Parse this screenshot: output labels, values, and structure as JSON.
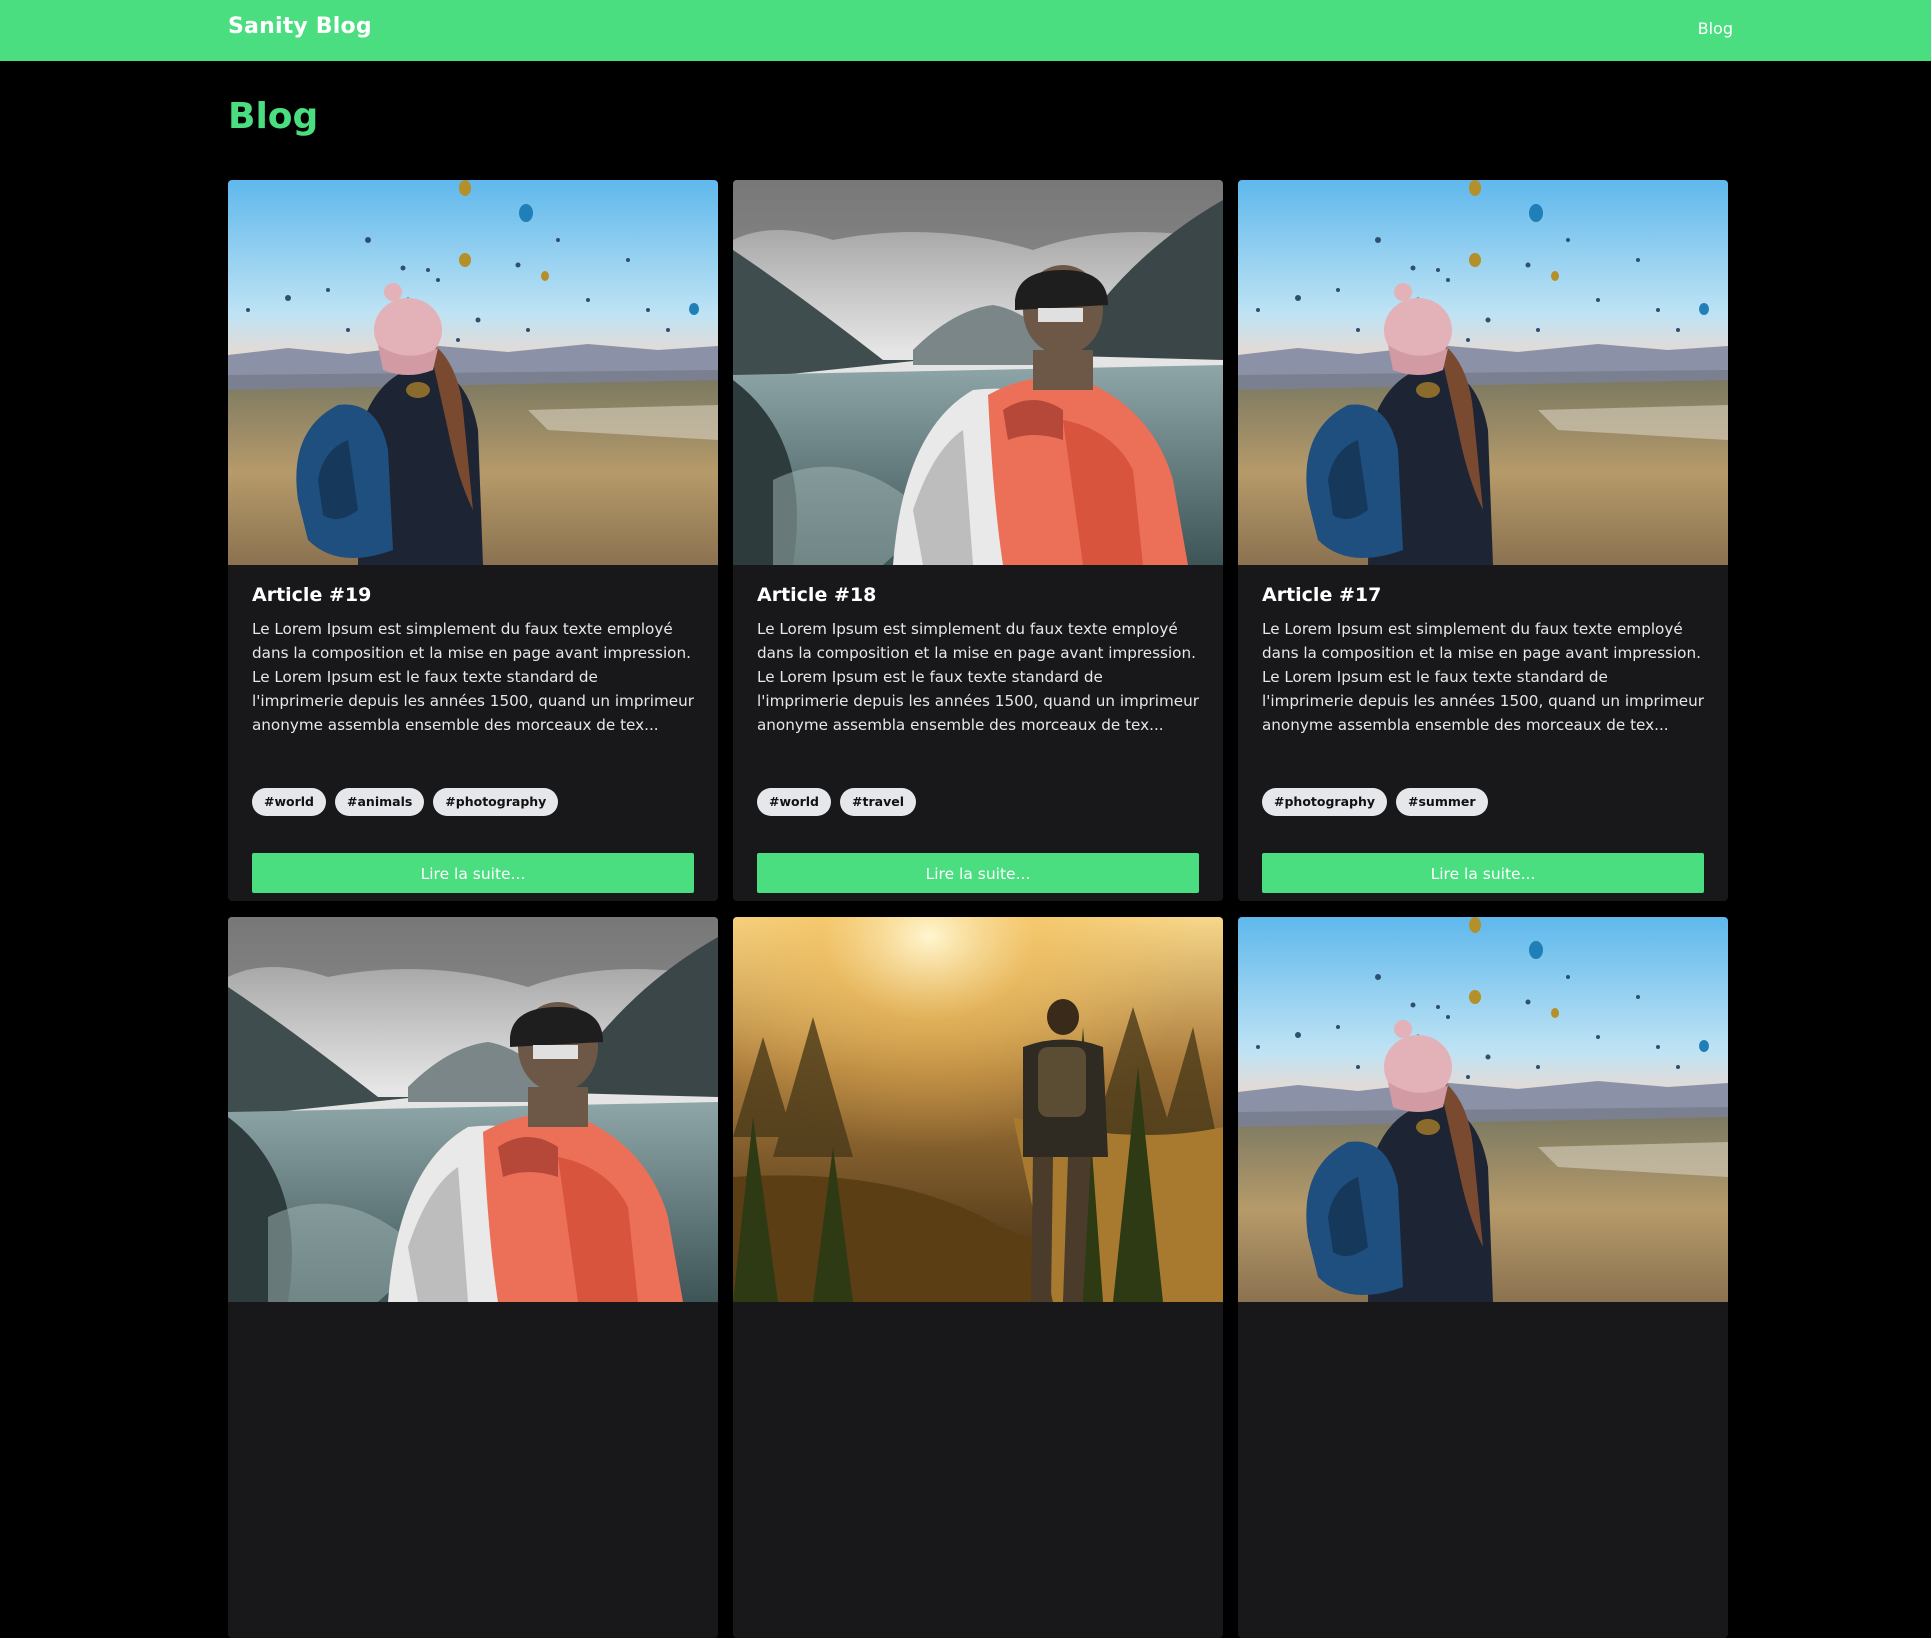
{
  "header": {
    "brand": "Sanity Blog",
    "nav": [
      {
        "label": "Blog"
      }
    ],
    "background_color": "#4ade80"
  },
  "page": {
    "title": "Blog",
    "accent_color": "#4ade80"
  },
  "cards": [
    {
      "title": "Article #19",
      "image": "woman-hot-air-balloons-photo",
      "excerpt": "Le Lorem Ipsum est simplement du faux texte employé dans la composition et la mise en page avant impression. Le Lorem Ipsum est le faux texte standard de l'imprimerie depuis les années 1500, quand un imprimeur anonyme assembla ensemble des morceaux de tex...",
      "tags": [
        "#world",
        "#animals",
        "#photography"
      ],
      "button": "Lire la suite..."
    },
    {
      "title": "Article #18",
      "image": "hiker-lake-mountains-photo",
      "excerpt": "Le Lorem Ipsum est simplement du faux texte employé dans la composition et la mise en page avant impression. Le Lorem Ipsum est le faux texte standard de l'imprimerie depuis les années 1500, quand un imprimeur anonyme assembla ensemble des morceaux de tex...",
      "tags": [
        "#world",
        "#travel"
      ],
      "button": "Lire la suite..."
    },
    {
      "title": "Article #17",
      "image": "woman-hot-air-balloons-photo",
      "excerpt": "Le Lorem Ipsum est simplement du faux texte employé dans la composition et la mise en page avant impression. Le Lorem Ipsum est le faux texte standard de l'imprimerie depuis les années 1500, quand un imprimeur anonyme assembla ensemble des morceaux de tex...",
      "tags": [
        "#photography",
        "#summer"
      ],
      "button": "Lire la suite..."
    },
    {
      "image": "hiker-lake-mountains-photo"
    },
    {
      "image": "hiker-forest-sunset-photo"
    },
    {
      "image": "woman-hot-air-balloons-photo"
    }
  ]
}
